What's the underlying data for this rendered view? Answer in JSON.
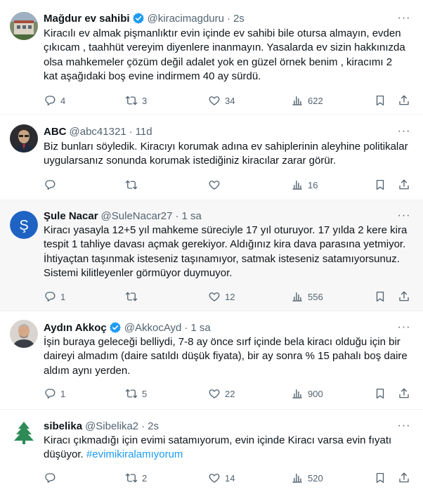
{
  "tweets": [
    {
      "name": "Mağdur ev sahibi",
      "verified": true,
      "handle": "@kiracimagduru",
      "time": "2s",
      "text": "Kiracılı ev almak pişmanlıktır evin içinde ev sahibi bile otursa almayın, evden çıkıcam , taahhüt vereyim diyenlere inanmayın. Yasalarda ev sizin hakkınızda olsa mahkemeler çözüm değil adalet yok en güzel örnek benim , kiracımı 2 kat aşağıdaki boş evine indirmem 40 ay sürdü.",
      "hashtag": "",
      "replies": "4",
      "retweets": "3",
      "likes": "34",
      "views": "622"
    },
    {
      "name": "ABC",
      "verified": false,
      "handle": "@abc41321",
      "time": "11d",
      "text": "Biz bunları söyledik. Kiracıyı korumak adına ev sahiplerinin aleyhine politikalar uygularsanız sonunda korumak istediğiniz kiracılar zarar görür.",
      "hashtag": "",
      "replies": "",
      "retweets": "",
      "likes": "",
      "views": "16"
    },
    {
      "name": "Şule Nacar",
      "verified": false,
      "handle": "@SuleNacar27",
      "time": "1 sa",
      "text": "Kiracı yasayla 12+5 yıl mahkeme süreciyle 17 yıl oturuyor. 17 yılda 2 kere kira tespit 1 tahliye davası açmak gerekiyor. Aldığınız kira dava parasına yetmiyor. İhtiyaçtan taşınmak isteseniz taşınamıyor, satmak isteseniz satamıyorsunuz. Sistemi kilitleyenler görmüyor duymuyor.",
      "hashtag": "",
      "replies": "1",
      "retweets": "",
      "likes": "12",
      "views": "556"
    },
    {
      "name": "Aydın Akkoç",
      "verified": true,
      "handle": "@AkkocAyd",
      "time": "1 sa",
      "text": "İşin buraya geleceği belliydi, 7-8 ay önce sırf içinde bela kiracı olduğu için bir daireyi almadım (daire satıldı düşük fiyata), bir ay sonra % 15 pahalı boş daire aldım aynı yerden.",
      "hashtag": "",
      "replies": "1",
      "retweets": "5",
      "likes": "22",
      "views": "900"
    },
    {
      "name": "sibelika",
      "verified": false,
      "handle": "@Sibelika2",
      "time": "2s",
      "text": "Kiracı çıkmadığı için evimi satamıyorum, evin içinde Kiracı varsa evin fıyatı düşüyor.",
      "hashtag": "#evimikiralamıyorum",
      "replies": "",
      "retweets": "2",
      "likes": "14",
      "views": "520"
    }
  ],
  "colors": {
    "accent": "#1d9bf0",
    "muted": "#536471",
    "highlight_bg": "#f7f7f7"
  },
  "icons": [
    "reply-icon",
    "retweet-icon",
    "like-icon",
    "views-icon",
    "bookmark-icon",
    "share-icon",
    "more-icon",
    "verified-badge-icon"
  ]
}
